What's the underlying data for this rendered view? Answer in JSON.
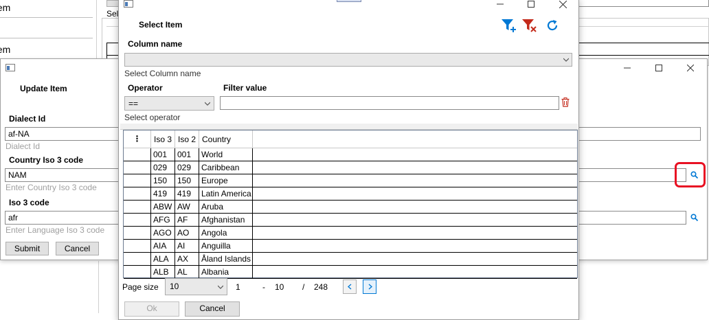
{
  "background": {
    "list_items": [
      "Item",
      "Item"
    ],
    "sel_label": "Sel"
  },
  "update_dialog": {
    "title": "Update Item",
    "dialect": {
      "label": "Dialect Id",
      "value": "af-NA",
      "hint": "Dialect Id"
    },
    "country": {
      "label": "Country Iso 3 code",
      "value": "NAM",
      "hint": "Enter Country Iso 3 code"
    },
    "iso3": {
      "label": "Iso 3 code",
      "value": "afr",
      "hint": "Enter Language Iso 3 code"
    },
    "submit_label": "Submit",
    "cancel_label": "Cancel"
  },
  "select_dialog": {
    "title": "Select Item",
    "column_name_label": "Column name",
    "column_name_value": "",
    "column_name_hint": "Select Column name",
    "operator_label": "Operator",
    "operator_value": "==",
    "operator_hint": "Select operator",
    "filter_value_label": "Filter value",
    "filter_value": "",
    "grid": {
      "menu_glyph": "⋮",
      "columns": [
        "Iso 3",
        "Iso 2",
        "Country"
      ],
      "rows": [
        [
          "001",
          "001",
          "World"
        ],
        [
          "029",
          "029",
          "Caribbean"
        ],
        [
          "150",
          "150",
          "Europe"
        ],
        [
          "419",
          "419",
          "Latin America"
        ],
        [
          "ABW",
          "AW",
          "Aruba"
        ],
        [
          "AFG",
          "AF",
          "Afghanistan"
        ],
        [
          "AGO",
          "AO",
          "Angola"
        ],
        [
          "AIA",
          "AI",
          "Anguilla"
        ],
        [
          "ALA",
          "AX",
          "Åland Islands"
        ],
        [
          "ALB",
          "AL",
          "Albania"
        ]
      ]
    },
    "pager": {
      "page_size_label": "Page size",
      "page_size_value": "10",
      "from": "1",
      "dash": "-",
      "to": "10",
      "slash": "/",
      "total": "248"
    },
    "ok_label": "Ok",
    "cancel_label": "Cancel"
  },
  "colors": {
    "accent_blue": "#0078d4",
    "danger_red": "#c42b1c",
    "highlight_red": "#e81123"
  }
}
